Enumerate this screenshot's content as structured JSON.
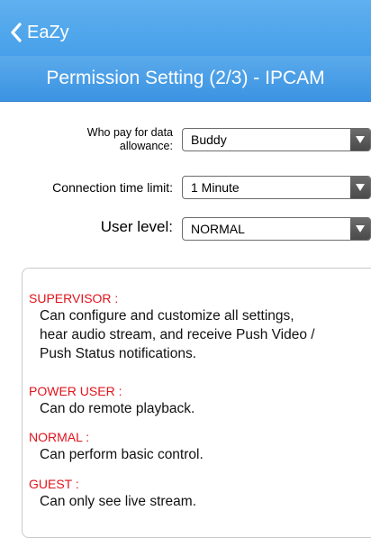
{
  "header": {
    "back_label": "EaZy",
    "title": "Permission Setting (2/3) - IPCAM"
  },
  "form": {
    "data_allowance": {
      "label_line1": "Who pay for data",
      "label_line2": "allowance:",
      "value": "Buddy"
    },
    "time_limit": {
      "label": "Connection time limit:",
      "value": "1 Minute"
    },
    "user_level": {
      "label": "User level:",
      "value": "NORMAL"
    }
  },
  "levels": [
    {
      "title": "SUPERVISOR :",
      "desc_lines": [
        "Can configure and customize all settings,",
        "hear audio stream, and receive Push Video /",
        "Push Status notifications."
      ]
    },
    {
      "title": "POWER USER :",
      "desc_lines": [
        "Can do remote playback."
      ]
    },
    {
      "title": "NORMAL :",
      "desc_lines": [
        "Can perform basic control."
      ]
    },
    {
      "title": "GUEST :",
      "desc_lines": [
        "Can only see live stream."
      ]
    }
  ],
  "colors": {
    "header_blue": "#3f9be8",
    "role_red": "#e0141c"
  }
}
